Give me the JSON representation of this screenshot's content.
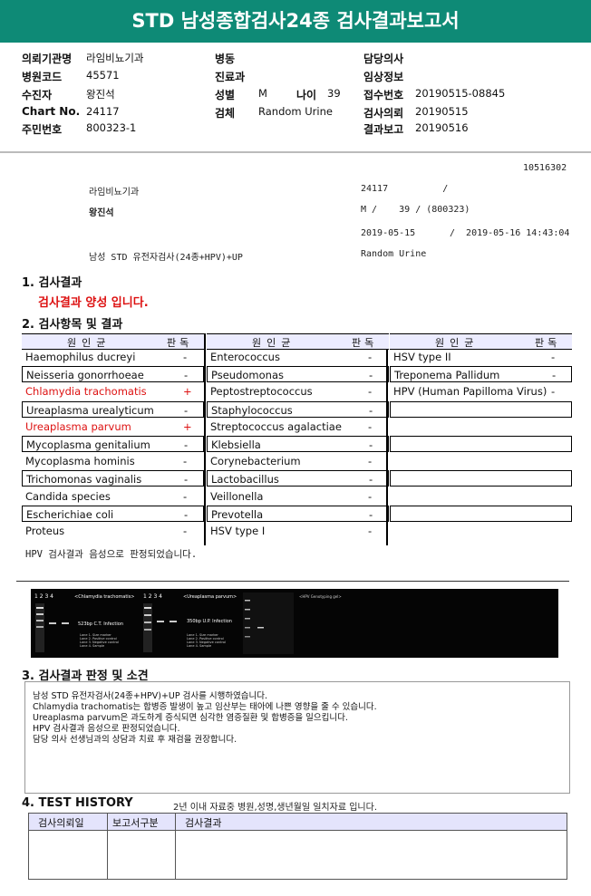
{
  "title": "STD 남성종합검사24종 검사결과보고서",
  "header": {
    "org_label": "의뢰기관명",
    "org_value": "라임비뇨기과",
    "code_label": "병원코드",
    "code_value": "45571",
    "patient_label": "수진자",
    "patient_value": "왕진석",
    "chart_label": "Chart No.",
    "chart_value": "24117",
    "id_label": "주민번호",
    "id_value": "800323-1",
    "ward_label": "병동",
    "dept_label": "진료과",
    "sex_label": "성별",
    "sex_value": "M",
    "age_label": "나이",
    "age_value": "39",
    "specimen_label": "검체",
    "specimen_value": "Random Urine",
    "doctor_label": "담당의사",
    "clinical_label": "임상정보",
    "accession_label": "접수번호",
    "accession_value": "20190515-08845",
    "requested_label": "검사의뢰",
    "requested_value": "20190515",
    "reported_label": "결과보고",
    "reported_value": "20190516"
  },
  "info": {
    "doc_no": "10516302",
    "clinic": "라임비뇨기과",
    "chart_no": "24117          /",
    "patient": "왕진석",
    "sex_age": "M /    39 / (800323)",
    "date_from": "2019-05-15",
    "date_to": "/  2019-05-16 14:43:04",
    "test_name": "남성 STD 유전자검사(24종+HPV)+UP",
    "specimen": "Random Urine"
  },
  "section1": {
    "title": "1. 검사결과",
    "result": "검사결과 양성 입니다."
  },
  "section2": {
    "title": "2. 검사항목 및 결과",
    "col_header_organism": "원인균",
    "col_header_result": "판독",
    "columns": [
      [
        {
          "name": "Haemophilus ducreyi",
          "result": "-"
        },
        {
          "name": "Neisseria gonorrhoeae",
          "result": "-"
        },
        {
          "name": "Chlamydia trachomatis",
          "result": "+"
        },
        {
          "name": "Ureaplasma urealyticum",
          "result": "-"
        },
        {
          "name": "Ureaplasma parvum",
          "result": "+"
        },
        {
          "name": "Mycoplasma genitalium",
          "result": "-"
        },
        {
          "name": "Mycoplasma hominis",
          "result": "-"
        },
        {
          "name": "Trichomonas vaginalis",
          "result": "-"
        },
        {
          "name": "Candida species",
          "result": "-"
        },
        {
          "name": "Escherichiae coli",
          "result": "-"
        },
        {
          "name": "Proteus",
          "result": "-"
        }
      ],
      [
        {
          "name": "Enterococcus",
          "result": "-"
        },
        {
          "name": "Pseudomonas",
          "result": "-"
        },
        {
          "name": "Peptostreptococcus",
          "result": "-"
        },
        {
          "name": "Staphylococcus",
          "result": "-"
        },
        {
          "name": "Streptococcus agalactiae",
          "result": "-"
        },
        {
          "name": "Klebsiella",
          "result": "-"
        },
        {
          "name": "Corynebacterium",
          "result": "-"
        },
        {
          "name": "Lactobacillus",
          "result": "-"
        },
        {
          "name": "Veillonella",
          "result": "-"
        },
        {
          "name": "Prevotella",
          "result": "-"
        },
        {
          "name": "HSV type I",
          "result": "-"
        }
      ],
      [
        {
          "name": "HSV type II",
          "result": "-"
        },
        {
          "name": "Treponema Pallidum",
          "result": "-"
        },
        {
          "name": "HPV (Human Papilloma Virus)",
          "result": "-"
        },
        {
          "name": "",
          "result": ""
        },
        {
          "name": "",
          "result": ""
        },
        {
          "name": "",
          "result": ""
        },
        {
          "name": "",
          "result": ""
        },
        {
          "name": "",
          "result": ""
        },
        {
          "name": "",
          "result": ""
        },
        {
          "name": "",
          "result": ""
        },
        {
          "name": "",
          "result": ""
        }
      ]
    ],
    "hpv_note": "HPV 검사결과 음성으로 판정되었습니다."
  },
  "gel": {
    "panel1_title": "<Chlamydia trachomatis>",
    "panel1_band": "523bp C.T. Infection",
    "panel2_title": "<Ureaplasma parvum>",
    "panel2_band": "350bp U.P. Infection",
    "panel3_title": "<HPV Genotyping gel>",
    "lane_numbers": "1  2  3  4",
    "legend_1": "Lane 1. Size marker",
    "legend_2": "Lane 2. Positive control",
    "legend_3": "Lane 3. Negative control",
    "legend_4": "Lane 4. Sample"
  },
  "section3": {
    "title": "3. 검사결과 판정 및 소견",
    "lines": [
      "남성 STD 유전자검사(24종+HPV)+UP 검사를 시행하였습니다.",
      "Chlamydia trachomatis는 합병증 발생이 높고 임산부는 태아에 나쁜 영향을 줄 수 있습니다.",
      "Ureaplasma parvum은 과도하게 증식되면 심각한 염증질환 및 합병증을 일으킵니다.",
      "HPV 검사결과 음성으로 판정되었습니다.",
      "담당 의사 선생님과의 상담과 치료 후 재검을 권장합니다."
    ]
  },
  "section4": {
    "title": "4. TEST HISTORY",
    "note": "2년 이내 자료중 병원,성명,생년월일 일치자료 입니다.",
    "col1": "검사의뢰일",
    "col2": "보고서구분",
    "col3": "검사결과"
  }
}
